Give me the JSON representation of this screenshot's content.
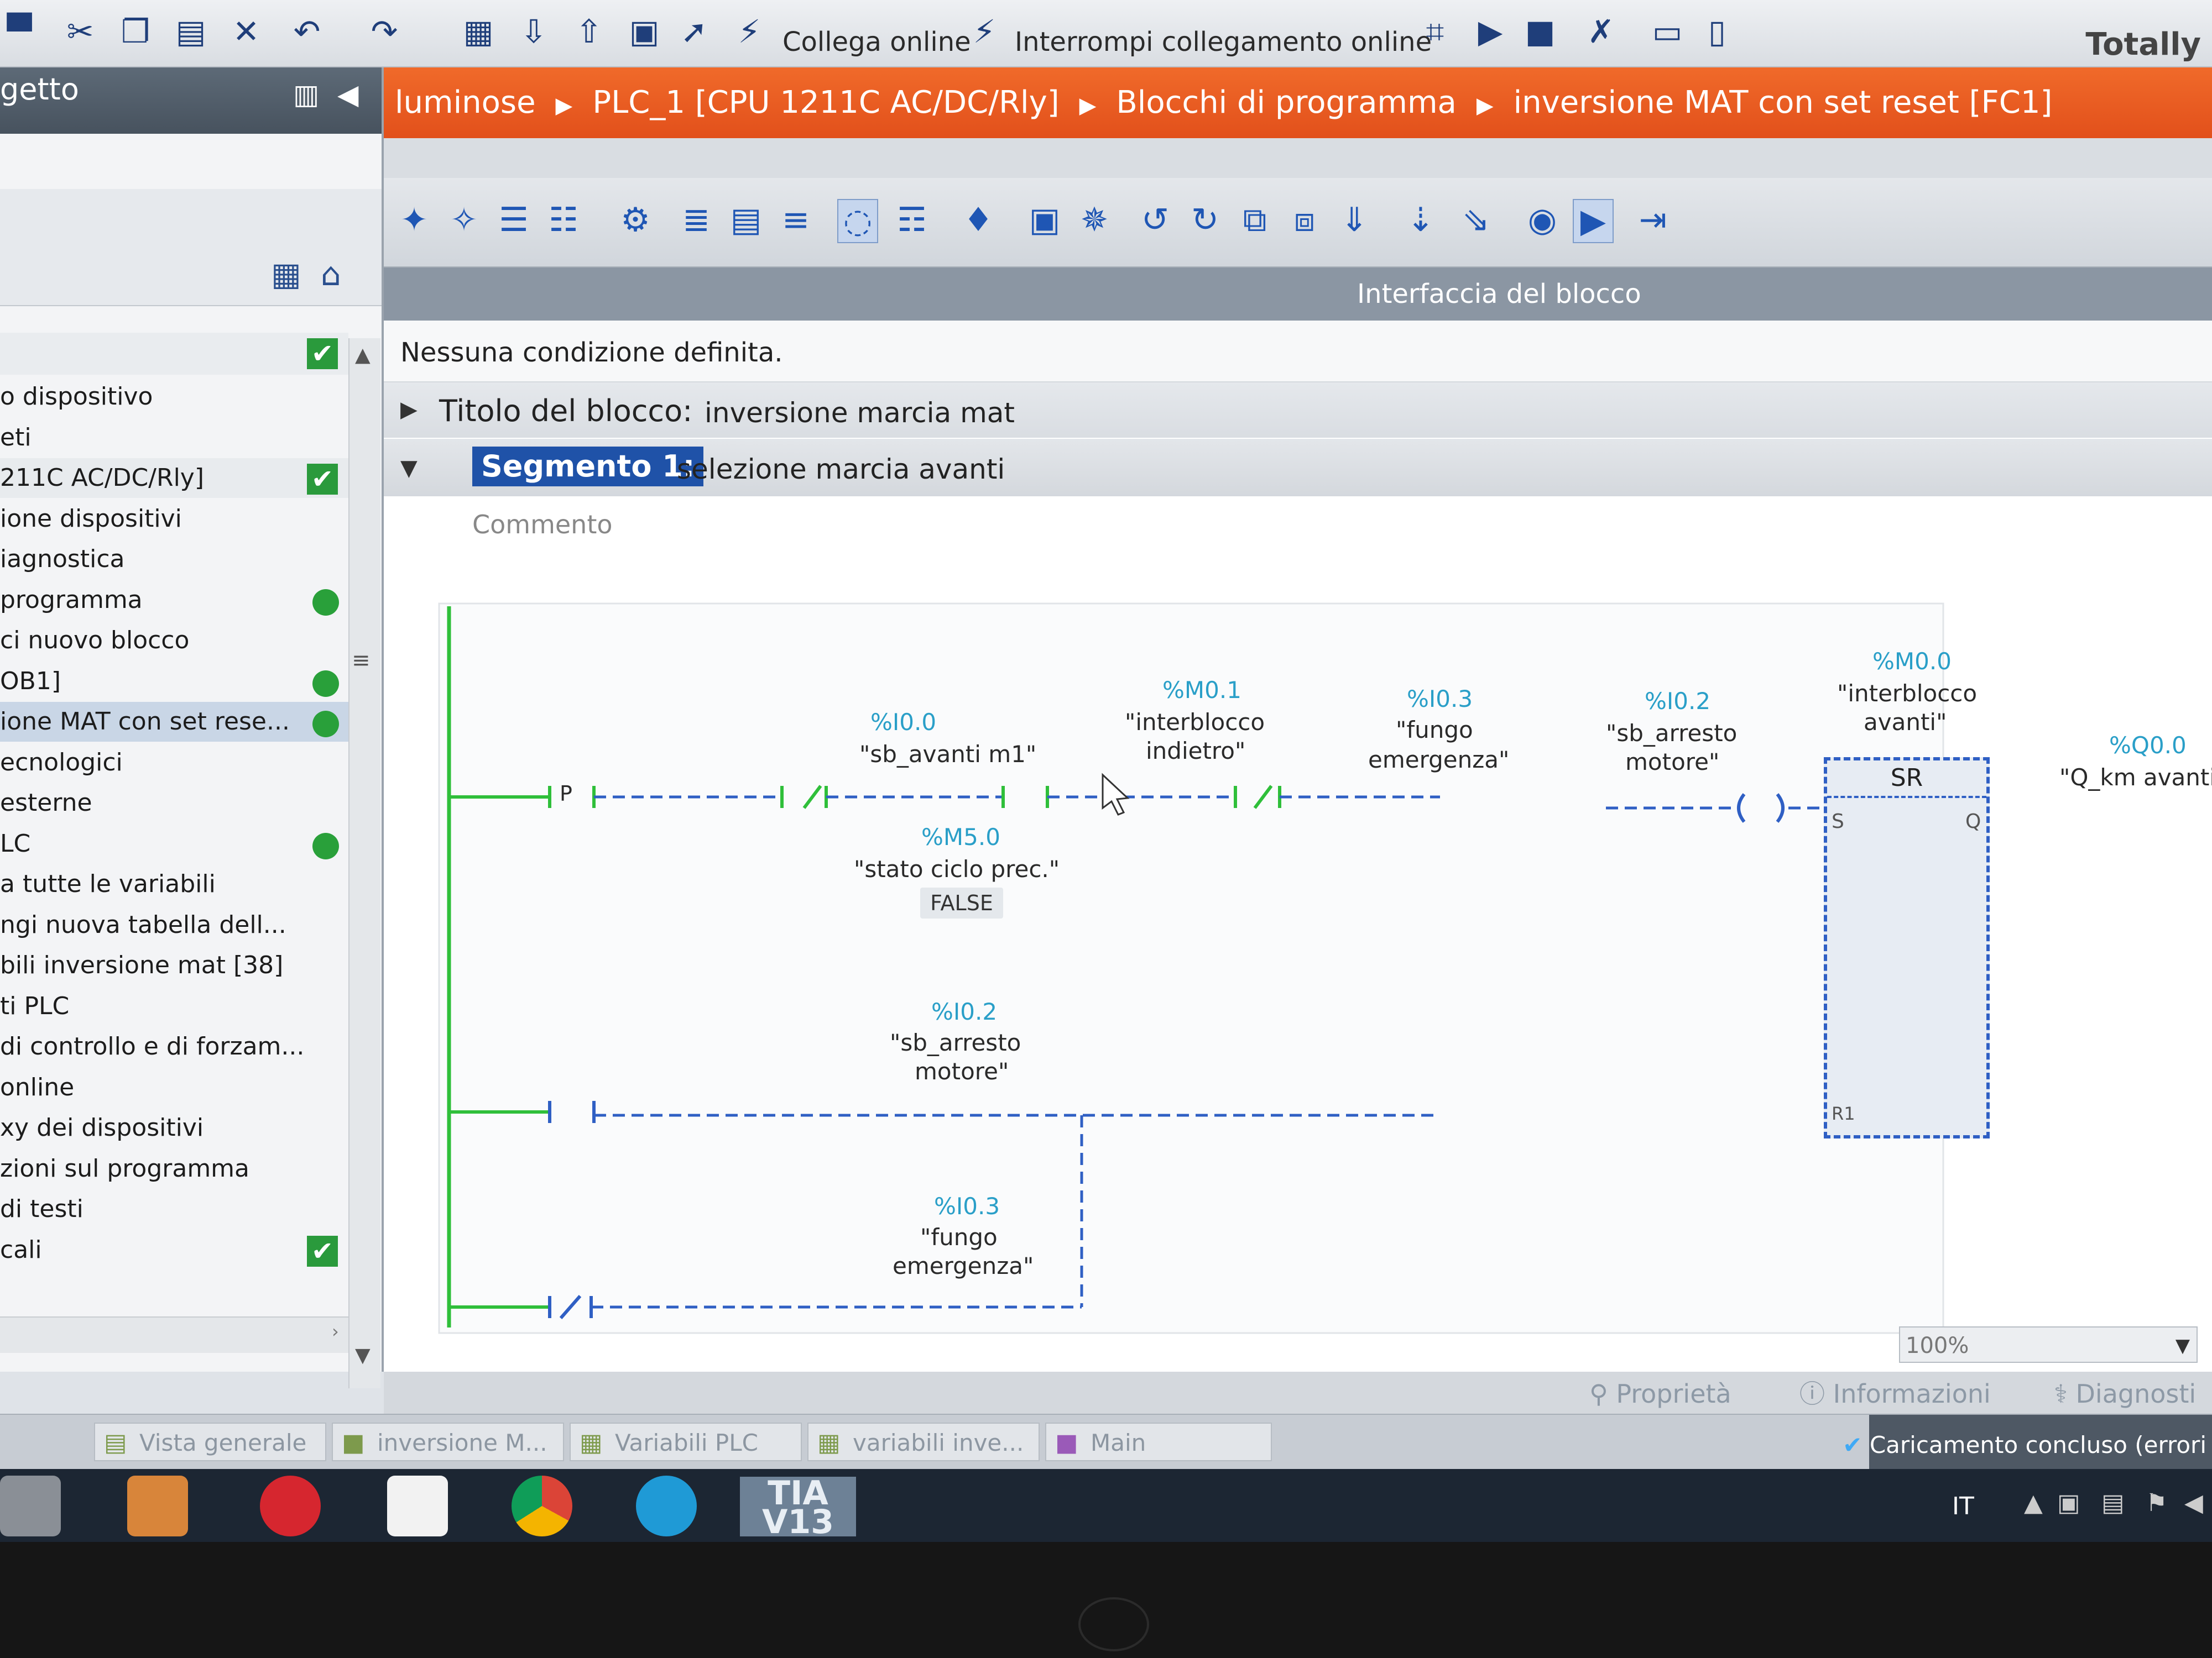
{
  "toolbar": {
    "go_online": "Collega online",
    "go_offline": "Interrompi collegamento online",
    "brand": "Totally"
  },
  "project_tree": {
    "title": "getto",
    "items": [
      {
        "label": "o dispositivo",
        "marker": ""
      },
      {
        "label": "eti",
        "marker": ""
      },
      {
        "label": "211C AC/DC/Rly]",
        "marker": "check"
      },
      {
        "label": "ione dispositivi",
        "marker": ""
      },
      {
        "label": "iagnostica",
        "marker": ""
      },
      {
        "label": "programma",
        "marker": "dot"
      },
      {
        "label": "ci nuovo blocco",
        "marker": ""
      },
      {
        "label": "OB1]",
        "marker": "dot"
      },
      {
        "label": "ione MAT con set rese...",
        "marker": "dot"
      },
      {
        "label": "ecnologici",
        "marker": ""
      },
      {
        "label": "esterne",
        "marker": ""
      },
      {
        "label": "LC",
        "marker": "dot"
      },
      {
        "label": "a tutte le variabili",
        "marker": ""
      },
      {
        "label": "ngi nuova tabella dell...",
        "marker": ""
      },
      {
        "label": "bili inversione mat [38]",
        "marker": ""
      },
      {
        "label": "ti PLC",
        "marker": ""
      },
      {
        "label": "di controllo e di forzam...",
        "marker": ""
      },
      {
        "label": "online",
        "marker": ""
      },
      {
        "label": "xy dei dispositivi",
        "marker": ""
      },
      {
        "label": "zioni sul programma",
        "marker": ""
      },
      {
        "label": "di testi",
        "marker": ""
      },
      {
        "label": "cali",
        "marker": "check"
      }
    ]
  },
  "breadcrumb": [
    "luminose",
    "PLC_1 [CPU 1211C AC/DC/Rly]",
    "Blocchi di programma",
    "inversione MAT con set reset [FC1]"
  ],
  "editor": {
    "interface_label": "Interfaccia del blocco",
    "condition": "Nessuna condizione definita.",
    "block_title_label": "Titolo del blocco:",
    "block_title_value": "inversione marcia mat",
    "segment_label": "Segmento 1:",
    "segment_value": "selezione marcia avanti",
    "comment_placeholder": "Commento",
    "zoom": "100%"
  },
  "ladder": {
    "contact_p": {
      "address": "%I0.0",
      "tag": "\"sb_avanti m1\"",
      "symbol": "P",
      "edge_address": "%M5.0",
      "edge_tag": "\"stato ciclo prec.\"",
      "edge_value": "FALSE"
    },
    "contact_interblocco_indietro": {
      "address": "%M0.1",
      "tag_line1": "\"interblocco",
      "tag_line2": "indietro\""
    },
    "contact_fungo": {
      "address": "%I0.3",
      "tag_line1": "\"fungo",
      "tag_line2": "emergenza\""
    },
    "contact_arresto": {
      "address": "%I0.2",
      "tag_line1": "\"sb_arresto",
      "tag_line2": "motore\""
    },
    "sr_block": {
      "address": "%M0.0",
      "tag_line1": "\"interblocco",
      "tag_line2": "avanti\"",
      "name": "SR",
      "pin_s": "S",
      "pin_q": "Q",
      "pin_r": "R1"
    },
    "coil": {
      "address": "%Q0.0",
      "tag": "\"Q_km avanti\""
    },
    "reset_arresto": {
      "address": "%I0.2",
      "tag_line1": "\"sb_arresto",
      "tag_line2": "motore\""
    },
    "reset_fungo": {
      "address": "%I0.3",
      "tag_line1": "\"fungo",
      "tag_line2": "emergenza\""
    }
  },
  "inspector_tabs": [
    "Proprietà",
    "Informazioni",
    "Diagnosti"
  ],
  "editor_tabs": [
    "Vista generale",
    "inversione M...",
    "Variabili PLC",
    "variabili inve...",
    "Main"
  ],
  "status": "Caricamento concluso (errori",
  "taskbar": {
    "tia_label": "TIA V13",
    "language": "IT"
  },
  "colors": {
    "breadcrumb": "#e8561f",
    "address": "#2a9fc8",
    "wire_active": "#2fbf3a",
    "wire_inactive": "#2f5fc4",
    "segment_highlight": "#1f52a8"
  }
}
